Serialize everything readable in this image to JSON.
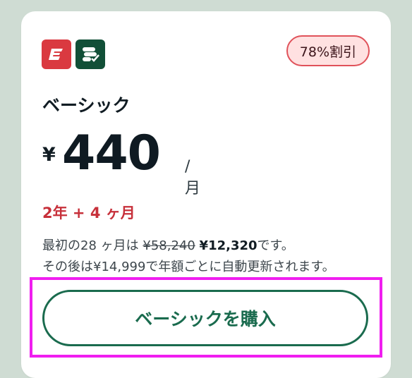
{
  "plan": {
    "icons": [
      "expressvpn-logo-icon",
      "setapp-logo-icon"
    ],
    "discount_badge": "78%割引",
    "name": "ベーシック",
    "currency": "¥",
    "price": "440",
    "per": "/月",
    "term": "2年 + 4 ヶ月",
    "line1_prefix": "最初の28 ヶ月は",
    "original_price": "¥58,240",
    "discounted_price": "¥12,320",
    "line1_suffix": "です。",
    "line2": "その後は¥14,999で年額ごとに自動更新されます。",
    "buy_label": "ベーシックを購入"
  },
  "colors": {
    "accent_green": "#1a6b4e",
    "discount_red": "#c7303a",
    "highlight_magenta": "#f01ef0"
  }
}
